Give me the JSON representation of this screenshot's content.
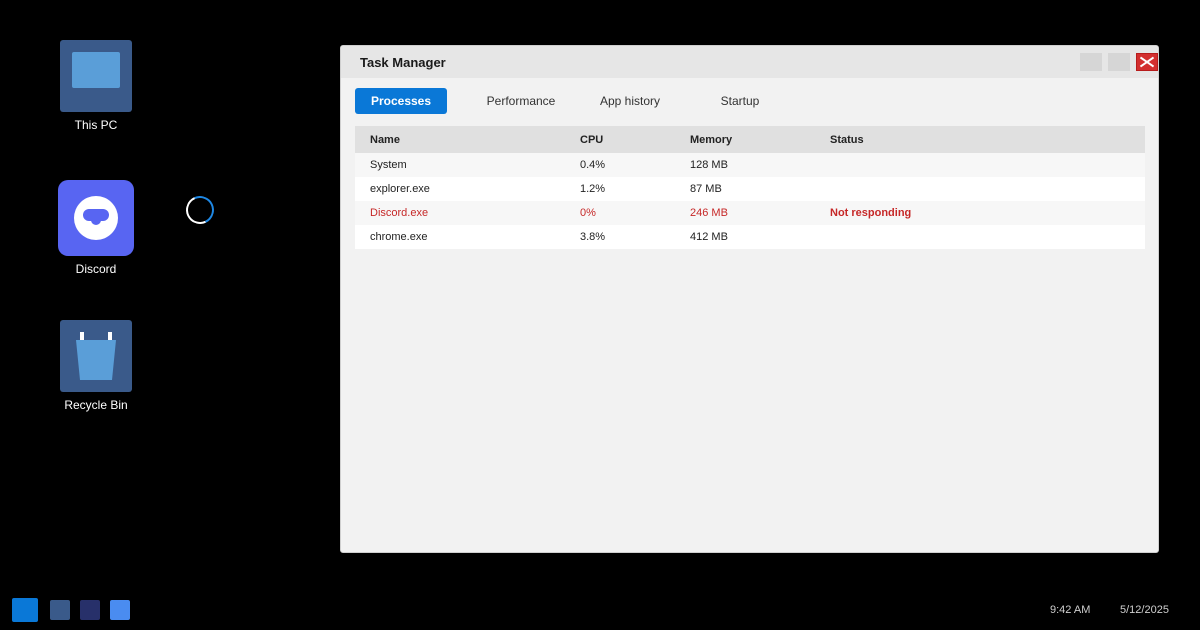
{
  "desktop": {
    "icons": [
      {
        "label": "This PC",
        "icon": "monitor-icon"
      },
      {
        "label": "Discord",
        "icon": "discord-icon"
      },
      {
        "label": "Recycle Bin",
        "icon": "recycle-bin-icon"
      }
    ],
    "loading_indicator": "spinner-icon"
  },
  "window": {
    "title": "Task Manager",
    "tabs": [
      {
        "label": "Processes",
        "active": true
      },
      {
        "label": "Performance",
        "active": false
      },
      {
        "label": "App history",
        "active": false
      },
      {
        "label": "Startup",
        "active": false
      }
    ],
    "table": {
      "columns": [
        "Name",
        "CPU",
        "Memory",
        "Status"
      ],
      "rows": [
        {
          "name": "System",
          "cpu": "0.4%",
          "memory": "128 MB",
          "status": ""
        },
        {
          "name": "explorer.exe",
          "cpu": "1.2%",
          "memory": "87 MB",
          "status": ""
        },
        {
          "name": "Discord.exe",
          "cpu": "0%",
          "memory": "246 MB",
          "status": "Not responding"
        },
        {
          "name": "chrome.exe",
          "cpu": "3.8%",
          "memory": "412 MB",
          "status": ""
        }
      ]
    }
  },
  "taskbar": {
    "time": "9:42 AM",
    "date": "5/12/2025"
  },
  "colors": {
    "accent": "#0a78d7",
    "alert": "#c62828",
    "discord": "#5865f2"
  }
}
